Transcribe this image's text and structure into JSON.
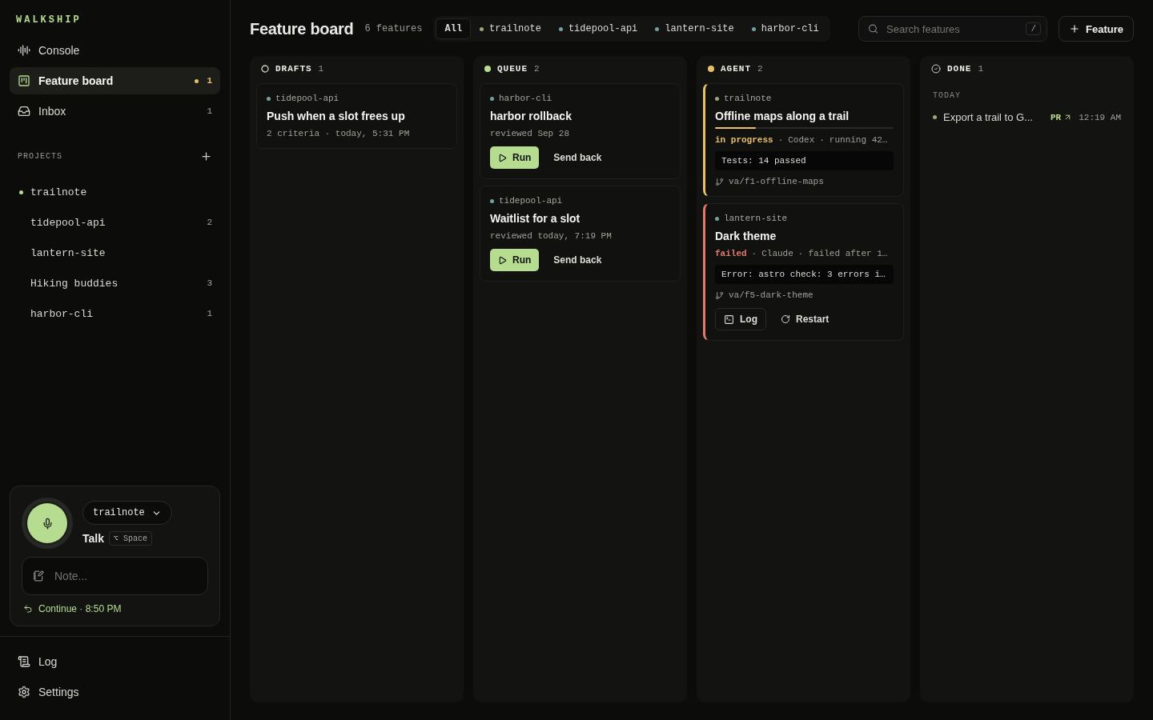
{
  "brand": "WALKSHIP",
  "nav": [
    {
      "label": "Console",
      "selected": false
    },
    {
      "label": "Feature board",
      "selected": true,
      "badge": "1",
      "unread": true
    },
    {
      "label": "Inbox",
      "selected": false,
      "badge": "1"
    }
  ],
  "projects": {
    "heading": "PROJECTS",
    "items": [
      {
        "name": "trailnote",
        "active": true
      },
      {
        "name": "tidepool-api",
        "active": false,
        "count": "2"
      },
      {
        "name": "lantern-site",
        "active": false
      },
      {
        "name": "Hiking buddies",
        "active": false,
        "count": "3"
      },
      {
        "name": "harbor-cli",
        "active": false,
        "count": "1"
      }
    ]
  },
  "voice": {
    "project": "trailnote",
    "talk": "Talk",
    "shortcut": "⌥ Space",
    "note_placeholder": "Note...",
    "continue": "Continue · 8:50 PM"
  },
  "footer_nav": [
    {
      "label": "Log"
    },
    {
      "label": "Settings"
    }
  ],
  "header": {
    "title": "Feature board",
    "count": "6 features",
    "filters": [
      {
        "label": "All",
        "selected": true
      },
      {
        "label": "trailnote",
        "selected": false,
        "color": "#9aa872"
      },
      {
        "label": "tidepool-api",
        "selected": false,
        "color": "#6fa3a0"
      },
      {
        "label": "lantern-site",
        "selected": false,
        "color": "#6fa3a0"
      },
      {
        "label": "harbor-cli",
        "selected": false,
        "color": "#6fa3a0"
      }
    ],
    "search_placeholder": "Search features",
    "search_shortcut": "/",
    "add_button": "Feature"
  },
  "columns": [
    {
      "title": "DRAFTS",
      "count": "1",
      "kind": "drafts",
      "cards": [
        {
          "kind": "draft",
          "project": "tidepool-api",
          "color": "#6fa3a0",
          "title": "Push when a slot frees up",
          "meta": "2 criteria · today, 5:31 PM"
        }
      ]
    },
    {
      "title": "QUEUE",
      "count": "2",
      "kind": "queue",
      "cards": [
        {
          "kind": "queue",
          "project": "harbor-cli",
          "color": "#6fa3a0",
          "title": "harbor rollback",
          "meta": "reviewed Sep 28",
          "run": "Run",
          "send_back": "Send back"
        },
        {
          "kind": "queue",
          "project": "tidepool-api",
          "color": "#6fa3a0",
          "title": "Waitlist for a slot",
          "meta": "reviewed today, 7:19 PM",
          "run": "Run",
          "send_back": "Send back"
        }
      ]
    },
    {
      "title": "AGENT",
      "count": "2",
      "kind": "agent",
      "cards": [
        {
          "kind": "agent",
          "status": {
            "label": "in progress",
            "color": "#e8c06a"
          },
          "project": "trailnote",
          "color": "#9aa872",
          "title": "Offline maps along a trail",
          "level": 0.23,
          "status_parts": [
            "·",
            "Codex",
            "·",
            "running 42…"
          ],
          "output": "Tests: 14 passed",
          "branch": "va/f1-offline-maps"
        },
        {
          "kind": "agent",
          "status": {
            "label": "failed",
            "color": "#e47a6a"
          },
          "project": "lantern-site",
          "color": "#6fa3a0",
          "title": "Dark theme",
          "status_parts": [
            "·",
            "Claude",
            "·",
            "failed after 1…"
          ],
          "output": "Error: astro check: 3 errors i…",
          "branch": "va/f5-dark-theme",
          "log": "Log",
          "restart": "Restart"
        }
      ]
    },
    {
      "title": "DONE",
      "count": "1",
      "kind": "done",
      "group": "TODAY",
      "cards": [
        {
          "kind": "done",
          "title": "Export a trail to G...",
          "color": "#9aa872",
          "pr": "PR",
          "time": "12:19 AM"
        }
      ]
    }
  ]
}
